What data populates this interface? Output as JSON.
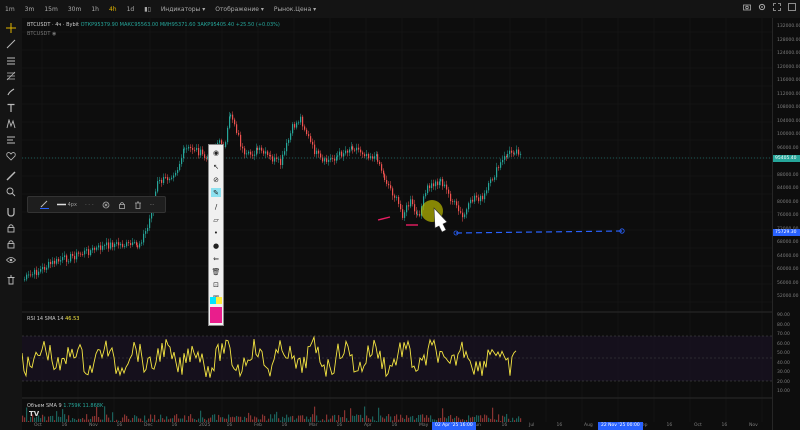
{
  "toolbar": {
    "timeframes": [
      "1m",
      "3m",
      "15m",
      "30m",
      "1h",
      "4h",
      "1d"
    ],
    "active_timeframe": "4h",
    "indicators_menu": "Индикаторы",
    "display_menu": "Отображение",
    "price_type_menu": "Рынок.Цена"
  },
  "legend": {
    "symbol": "BTCUSDT · 4ч · Bybit",
    "open": "ОТКР95379.90",
    "high": "МАКС95563.00",
    "low": "МИН95371.60",
    "close": "ЗАКР95405.40",
    "change": "+25.50 (+0.03%)",
    "compare_symbol": "BTCUSDT"
  },
  "price_axis": {
    "ticks": [
      "132000.00",
      "128000.00",
      "124000.00",
      "120000.00",
      "116000.00",
      "112000.00",
      "108000.00",
      "104000.00",
      "100000.00",
      "96000.00",
      "92000.00",
      "88000.00",
      "84000.00",
      "80000.00",
      "76000.00",
      "72000.00",
      "68000.00",
      "64000.00",
      "60000.00",
      "56000.00",
      "52000.00"
    ],
    "current_price": "95405.40",
    "line_price": "75729.30"
  },
  "rsi": {
    "label": "RSI 14 SMA 14",
    "value": "46.53",
    "ticks": [
      "90.00",
      "80.00",
      "70.00",
      "60.00",
      "50.00",
      "40.00",
      "30.00",
      "20.00",
      "10.00"
    ]
  },
  "volume": {
    "label": "Объем SMA 9",
    "value1": "1.759K",
    "value2": "11.868K"
  },
  "time_axis": {
    "labels": [
      "Oct",
      "16",
      "Nov",
      "16",
      "Dec",
      "16",
      "2025",
      "16",
      "Feb",
      "16",
      "Mar",
      "16",
      "Apr",
      "16",
      "May",
      "16",
      "Jun",
      "16",
      "Jul",
      "16",
      "Aug",
      "16",
      "Sep",
      "16",
      "Oct",
      "16",
      "Nov"
    ],
    "highlight_start": "02 Apr '25   16:00",
    "highlight_end": "22 Nov '25   00:00"
  },
  "float_toolbar": {
    "width_label": "4px",
    "more": "···"
  },
  "colors": {
    "bull": "#26a69a",
    "bear": "#ef5350",
    "rsi_line": "#f5e642",
    "dash_line": "#2962ff",
    "marker": "#e91e63",
    "highlight": "#c8c800"
  }
}
